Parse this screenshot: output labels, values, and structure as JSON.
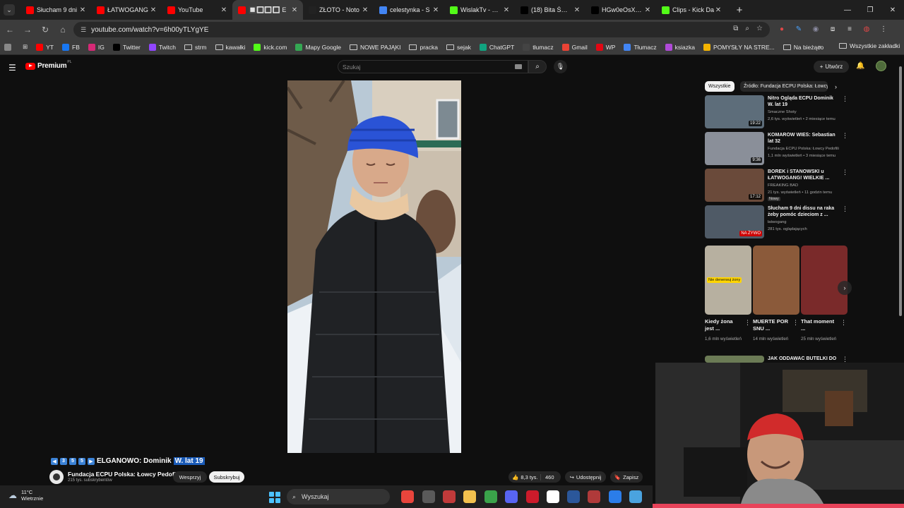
{
  "tabs": [
    {
      "title": "Słucham 9 dni",
      "color": "#ff0000"
    },
    {
      "title": "ŁATWOGANG",
      "color": "#ff0000"
    },
    {
      "title": "YouTube",
      "color": "#ff0000"
    },
    {
      "title": "🔲🔳🔳🔳 E",
      "color": "#ff0000"
    },
    {
      "title": "ZŁOTO - Noto",
      "color": "#222"
    },
    {
      "title": "celestynka - S",
      "color": "#4285f4"
    },
    {
      "title": "WislakTv - Wat",
      "color": "#53fc18"
    },
    {
      "title": "(18) Bita Śmiet",
      "color": "#000"
    },
    {
      "title": "HGw0eOsXQA",
      "color": "#000"
    },
    {
      "title": "Clips - Kick Da",
      "color": "#53fc18"
    }
  ],
  "omnibox": {
    "url": "youtube.com/watch?v=6h00yTLYgYE"
  },
  "bookmarks": [
    {
      "label": "YT",
      "icon": "youtube-icon",
      "color": "#ff0000"
    },
    {
      "label": "FB",
      "icon": "facebook-icon",
      "color": "#1877f2"
    },
    {
      "label": "IG",
      "icon": "instagram-icon",
      "color": "#d62976"
    },
    {
      "label": "Twitter",
      "icon": "x-icon",
      "color": "#000000"
    },
    {
      "label": "Twitch",
      "icon": "twitch-icon",
      "color": "#9146ff"
    },
    {
      "label": "strm",
      "icon": "folder-icon",
      "color": ""
    },
    {
      "label": "kawałki",
      "icon": "folder-icon",
      "color": ""
    },
    {
      "label": "kick.com",
      "icon": "kick-icon",
      "color": "#53fc18"
    },
    {
      "label": "Mapy Google",
      "icon": "maps-icon",
      "color": "#34a853"
    },
    {
      "label": "NOWE PAJĄKI",
      "icon": "folder-icon",
      "color": ""
    },
    {
      "label": "pracka",
      "icon": "folder-icon",
      "color": ""
    },
    {
      "label": "sejak",
      "icon": "folder-icon",
      "color": ""
    },
    {
      "label": "ChatGPT",
      "icon": "chatgpt-icon",
      "color": "#10a37f"
    },
    {
      "label": "tłumacz",
      "icon": "translate-icon",
      "color": "#444"
    },
    {
      "label": "Gmail",
      "icon": "gmail-icon",
      "color": "#ea4335"
    },
    {
      "label": "WP",
      "icon": "wp-icon",
      "color": "#e30613"
    },
    {
      "label": "Tłumacz",
      "icon": "translate-icon",
      "color": "#4285f4"
    },
    {
      "label": "ksiazka",
      "icon": "book-icon",
      "color": "#b04ad8"
    },
    {
      "label": "POMYSŁY NA STRE...",
      "icon": "sheets-icon",
      "color": "#f4b400"
    },
    {
      "label": "Na bieżąco",
      "icon": "folder-icon",
      "color": ""
    }
  ],
  "bookmarks_all": "Wszystkie zakładki",
  "youtube": {
    "logo_text": "Premium",
    "logo_sup": "PL",
    "search_placeholder": "Szukaj",
    "create_label": "Utwórz"
  },
  "video": {
    "title_prefix": "ELGANOWO: Dominik",
    "title_highlight": "W. lat 19",
    "emojis": [
      "◀",
      "3",
      "5",
      "5",
      "▶"
    ],
    "channel": "Fundacja ECPU Polska: Łowcy Pedofili",
    "subscribers": "215 tys. subskrybentów",
    "support_label": "Wesprzyj",
    "subscribe_label": "Subskrybuj",
    "likes": "8,3 tys.",
    "dislikes": "460",
    "share_label": "Udostępnij",
    "save_label": "Zapisz"
  },
  "chips": {
    "active": "Wszystkie",
    "second": "Źródło: Fundacja ECPU Polska: Łowcy"
  },
  "recommendations": [
    {
      "title": "Nitro Ogląda ECPU Dominik W. lat 19",
      "channel": "Smaczne Shoty",
      "meta": "2,6 tys. wyświetleń • 2 miesiące temu",
      "duration": "19:22",
      "badge": "",
      "live": ""
    },
    {
      "title": "KOMARÓW WIEŚ: Sebastian lat 32",
      "channel": "Fundacja ECPU Polska: Łowcy Pedofili",
      "meta": "1,1 mln wyświetleń • 3 miesiące temu",
      "duration": "9:36",
      "badge": "",
      "live": ""
    },
    {
      "title": "BOREK i STANOWSKI u ŁATWOGANG! WIELKIE ...",
      "channel": "FREAKING BAD",
      "meta": "21 tys. wyświetleń • 11 godzin temu",
      "duration": "17:12",
      "badge": "Nowy",
      "live": ""
    },
    {
      "title": "Słucham 9 dni dissu na raka żeby pomóc dzieciom z ...",
      "channel": "łatwogang",
      "meta": "281 tys. oglądających",
      "duration": "",
      "badge": "",
      "live": "NA ŻYWO"
    }
  ],
  "shorts": [
    {
      "title": "Kiedy żona jest ...",
      "views": "1,6 mln wyświetleń",
      "caption": "Nie denerwuj żony"
    },
    {
      "title": "MUERTE POR SNU ...",
      "views": "14 mln wyświetleń",
      "caption": ""
    },
    {
      "title": "That moment ...",
      "views": "25 mln wyświetleń",
      "caption": ""
    }
  ],
  "partial_rec": {
    "title": "JAK ODDAWAĆ BUTELKI DO"
  },
  "taskbar": {
    "temperature": "11°C",
    "weather": "Wietrznie",
    "search": "Wyszukaj"
  }
}
